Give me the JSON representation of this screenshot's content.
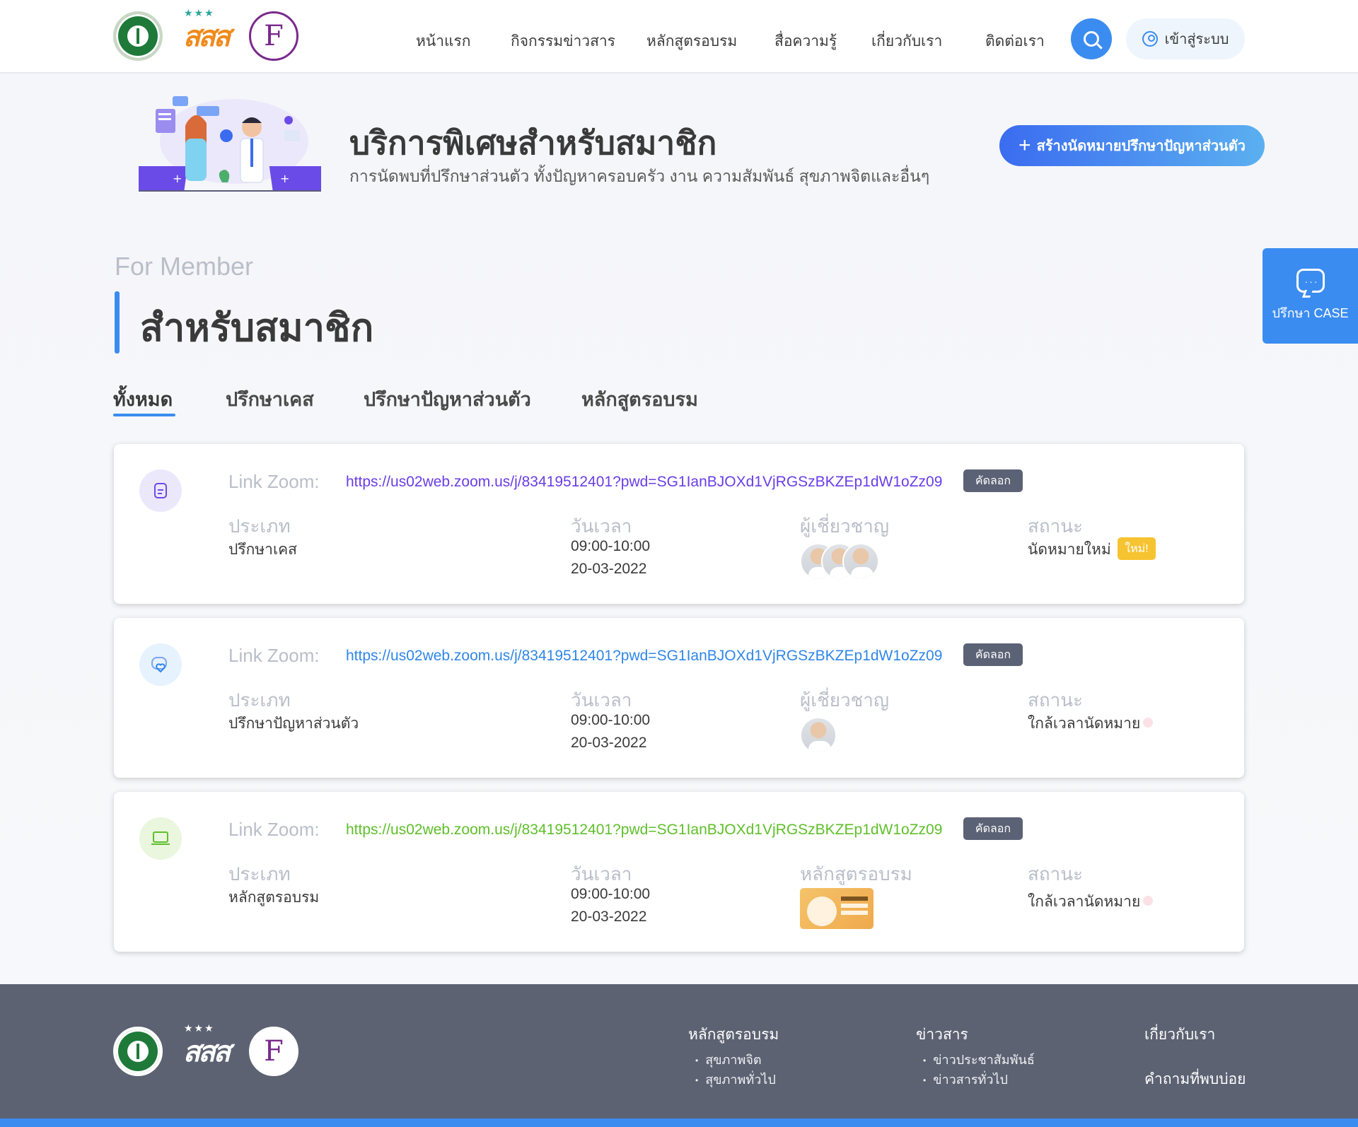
{
  "header": {
    "logos": [
      "moph-logo",
      "sss-logo",
      "face-foundation-logo"
    ],
    "sss_text": "สสส",
    "face_text": "F",
    "nav": [
      "หน้าแรก",
      "กิจกรรมข่าวสาร",
      "หลักสูตรอบรม",
      "สื่อความรู้",
      "เกี่ยวกับเรา",
      "ติดต่อเรา"
    ],
    "login_label": "เข้าสู่ระบบ"
  },
  "hero": {
    "title": "บริการพิเศษสำหรับสมาชิก",
    "subtitle": "การนัดพบที่ปรึกษาส่วนตัว ทั้งปัญหาครอบครัว งาน ความสัมพันธ์ สุขภาพจิตและอื่นๆ",
    "create_button": "สร้างนัดหมายปรึกษาปัญหาส่วนตัว",
    "create_icon": "plus"
  },
  "side_button": {
    "label": "ปรึกษา CASE",
    "icon": "chat-bubble-icon"
  },
  "section": {
    "eyebrow": "For Member",
    "title": "สำหรับสมาชิก"
  },
  "tabs": [
    "ทั้งหมด",
    "ปรึกษาเคส",
    "ปรึกษาปัญหาส่วนตัว",
    "หลักสูตรอบรม"
  ],
  "labels": {
    "link": "Link Zoom:",
    "copy": "คัดลอก",
    "type": "ประเภท",
    "datetime": "วันเวลา",
    "expert": "ผู้เชี่ยวชาญ",
    "course": "หลักสูตรอบรม",
    "status": "สถานะ"
  },
  "appointments": [
    {
      "icon": "document-icon",
      "url": "https://us02web.zoom.us/j/83419512401?pwd=SG1IanBJOXd1VjRGSzBKZEp1dW1oZz09",
      "url_color": "#6a3de8",
      "type": "ปรึกษาเคส",
      "time": "09:00-10:00",
      "date": "20-03-2022",
      "status": "นัดหมายใหม่",
      "badge": "ใหม่!"
    },
    {
      "icon": "heart-chat-icon",
      "url": "https://us02web.zoom.us/j/83419512401?pwd=SG1IanBJOXd1VjRGSzBKZEp1dW1oZz09",
      "url_color": "#2f86e8",
      "type": "ปรึกษาปัญหาส่วนตัว",
      "time": "09:00-10:00",
      "date": "20-03-2022",
      "status": "ใกล้เวลานัดหมาย"
    },
    {
      "icon": "laptop-icon",
      "url": "https://us02web.zoom.us/j/83419512401?pwd=SG1IanBJOXd1VjRGSzBKZEp1dW1oZz09",
      "url_color": "#5fbf2a",
      "type": "หลักสูตรอบรม",
      "time": "09:00-10:00",
      "date": "20-03-2022",
      "status": "ใกล้เวลานัดหมาย"
    }
  ],
  "footer": {
    "col1_title": "หลักสูตรอบรม",
    "col1_items": [
      "สุขภาพจิต",
      "สุขภาพทั่วไป"
    ],
    "col2_title": "ข่าวสาร",
    "col2_items": [
      "ข่าวประชาสัมพันธ์",
      "ข่าวสารทั่วไป"
    ],
    "col3_items": [
      "เกี่ยวกับเรา",
      "คำถามที่พบบ่อย"
    ]
  },
  "colors": {
    "accent": "#3b8cf0",
    "footer_bg": "#5c6272",
    "new_badge": "#f6c331"
  }
}
